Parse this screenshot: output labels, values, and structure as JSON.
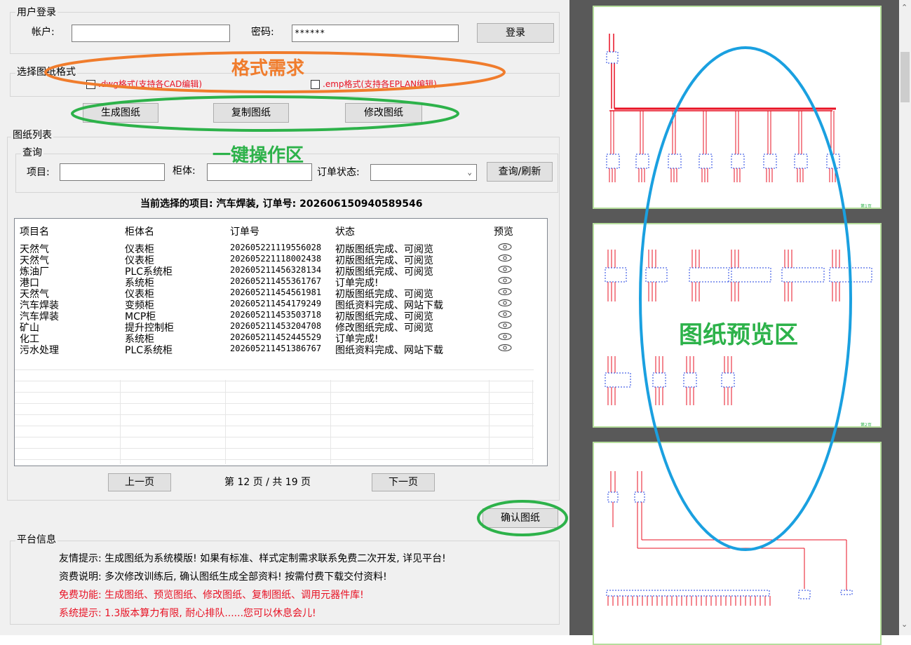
{
  "login": {
    "group_title": "用户登录",
    "account_label": "帐户:",
    "account_value": "",
    "password_label": "密码:",
    "password_value": "******",
    "login_button": "登录"
  },
  "format": {
    "group_title": "选择图纸格式",
    "dwg_option": ".dwg格式(支持各CAD编辑)",
    "emp_option": ".emp格式(支持各EPLAN编辑)",
    "dwg_checked": false,
    "emp_checked": false
  },
  "actions": {
    "generate": "生成图纸",
    "copy": "复制图纸",
    "modify": "修改图纸"
  },
  "list": {
    "group_title": "图纸列表",
    "query_title": "查询",
    "project_label": "项目:",
    "project_value": "",
    "cabinet_label": "柜体:",
    "cabinet_value": "",
    "status_label": "订单状态:",
    "status_value": "",
    "query_button": "查询/刷新",
    "current_selection": "当前选择的项目: 汽车焊装, 订单号: 202606150940589546",
    "columns": [
      "项目名",
      "柜体名",
      "订单号",
      "状态",
      "预览"
    ],
    "rows": [
      {
        "project": "天然气",
        "cabinet": "仪表柜",
        "order": "202605221119556028",
        "status": "初版图纸完成、可阅览"
      },
      {
        "project": "天然气",
        "cabinet": "仪表柜",
        "order": "202605221118002438",
        "status": "初版图纸完成、可阅览"
      },
      {
        "project": "炼油厂",
        "cabinet": "PLC系统柜",
        "order": "202605211456328134",
        "status": "初版图纸完成、可阅览"
      },
      {
        "project": "港口",
        "cabinet": "系统柜",
        "order": "202605211455361767",
        "status": "订单完成!"
      },
      {
        "project": "天然气",
        "cabinet": "仪表柜",
        "order": "202605211454561981",
        "status": "初版图纸完成、可阅览"
      },
      {
        "project": "汽车焊装",
        "cabinet": "变频柜",
        "order": "202605211454179249",
        "status": "图纸资料完成、网站下载"
      },
      {
        "project": "汽车焊装",
        "cabinet": "MCP柜",
        "order": "202605211453503718",
        "status": "初版图纸完成、可阅览"
      },
      {
        "project": "矿山",
        "cabinet": "提升控制柜",
        "order": "202605211453204708",
        "status": "修改图纸完成、可阅览"
      },
      {
        "project": "化工",
        "cabinet": "系统柜",
        "order": "202605211452445529",
        "status": "订单完成!"
      },
      {
        "project": "污水处理",
        "cabinet": "PLC系统柜",
        "order": "202605211451386767",
        "status": "图纸资料完成、网站下载"
      }
    ],
    "preview_icon": "eye-icon",
    "prev_button": "上一页",
    "next_button": "下一页",
    "page_info": "第 12 页 / 共 19 页",
    "confirm_button": "确认图纸"
  },
  "platform": {
    "group_title": "平台信息",
    "line1": "友情提示: 生成图纸为系统模版! 如果有标准、样式定制需求联系免费二次开发, 详见平台!",
    "line2": "资费说明: 多次修改训练后, 确认图纸生成全部资料! 按需付费下载交付资料!",
    "line3": "免费功能: 生成图纸、预览图纸、修改图纸、复制图纸、调用元器件库!",
    "line4": "系统提示: 1.3版本算力有限, 耐心排队......您可以休息会儿!"
  },
  "annotations": {
    "format_demand": "格式需求",
    "one_click_area": "一键操作区",
    "preview_area": "图纸预览区"
  },
  "colors": {
    "orange": "#f07c2c",
    "green": "#2db24a",
    "blue": "#1aa0e0",
    "wire_red": "#e81123",
    "block_blue": "#1c3fe0"
  }
}
